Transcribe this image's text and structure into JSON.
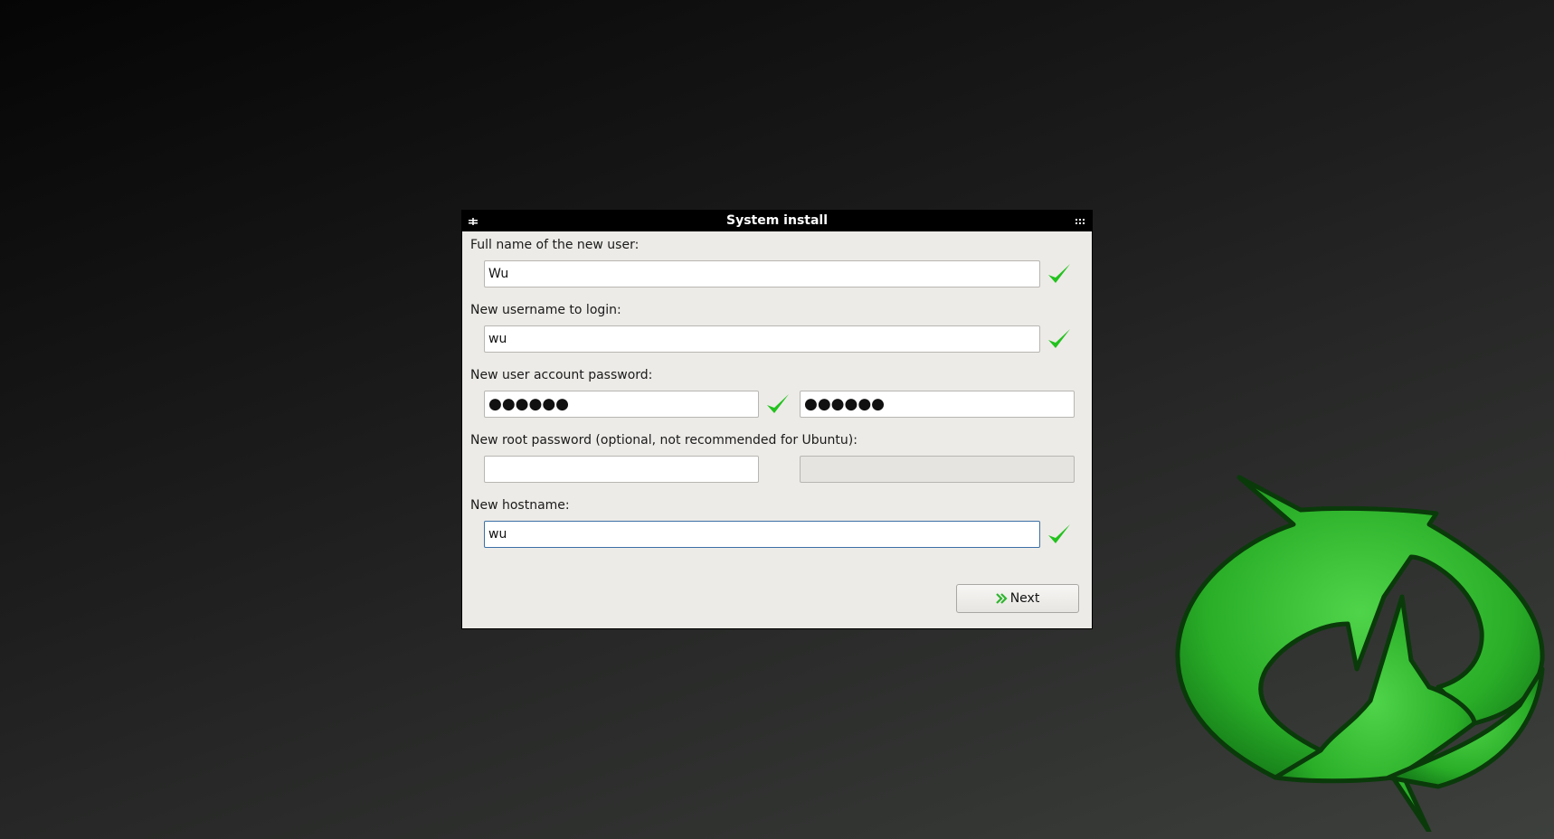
{
  "window": {
    "title": "System install",
    "menu_icon": "window-menu-icon",
    "grip_icon": "window-grip-icon"
  },
  "form": {
    "full_name": {
      "label": "Full name of the new user:",
      "value": "Wu",
      "valid": true
    },
    "username": {
      "label": "New username to login:",
      "value": "wu",
      "valid": true
    },
    "user_password": {
      "label": "New user account password:",
      "value_masked": "●●●●●●",
      "confirm_masked": "●●●●●●",
      "valid": true
    },
    "root_password": {
      "label": "New root password (optional, not recommended for Ubuntu):",
      "value": "",
      "confirm_value": ""
    },
    "hostname": {
      "label": "New hostname:",
      "value": "wu",
      "valid": true
    }
  },
  "buttons": {
    "next_label": "Next",
    "next_icon": "double-chevron-right-icon"
  },
  "colors": {
    "check_green": "#22c21e",
    "logo_green": "#2fb52f",
    "titlebar": "#000000",
    "dialog_bg": "#edebe7",
    "focus_border": "#3b6fa6"
  },
  "background_logo": "refresh-arrows-logo"
}
